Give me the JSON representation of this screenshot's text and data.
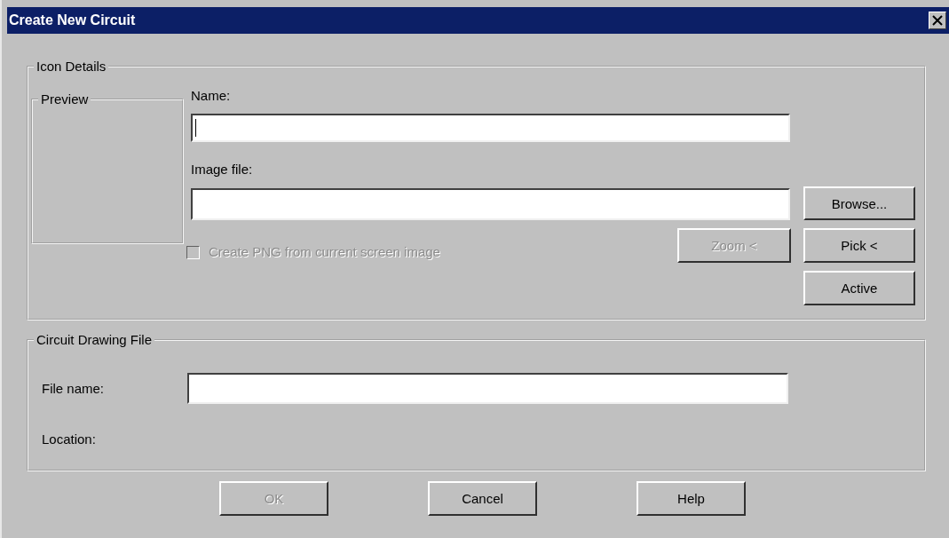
{
  "window": {
    "title": "Create New Circuit"
  },
  "icon_details": {
    "title": "Icon Details",
    "preview": {
      "title": "Preview"
    },
    "name_field": {
      "label": "Name:",
      "focused": true
    },
    "image_file_field": {
      "label": "Image file:"
    },
    "create_png": {
      "label": "Create PNG from current screen image",
      "checked": false,
      "disabled": true
    },
    "zoom_button": {
      "label": "Zoom <",
      "disabled": true
    },
    "side_buttons": [
      {
        "label": "Browse...",
        "disabled": false
      },
      {
        "label": "Pick <",
        "disabled": false
      },
      {
        "label": "Active",
        "disabled": false
      }
    ]
  },
  "circuit_drawing_file": {
    "title": "Circuit Drawing File",
    "file_name_field": {
      "label": "File name:"
    },
    "location": {
      "label": "Location:"
    }
  },
  "buttons": [
    {
      "label": "OK",
      "disabled": true
    },
    {
      "label": "Cancel",
      "disabled": false
    },
    {
      "label": "Help",
      "disabled": false
    }
  ]
}
